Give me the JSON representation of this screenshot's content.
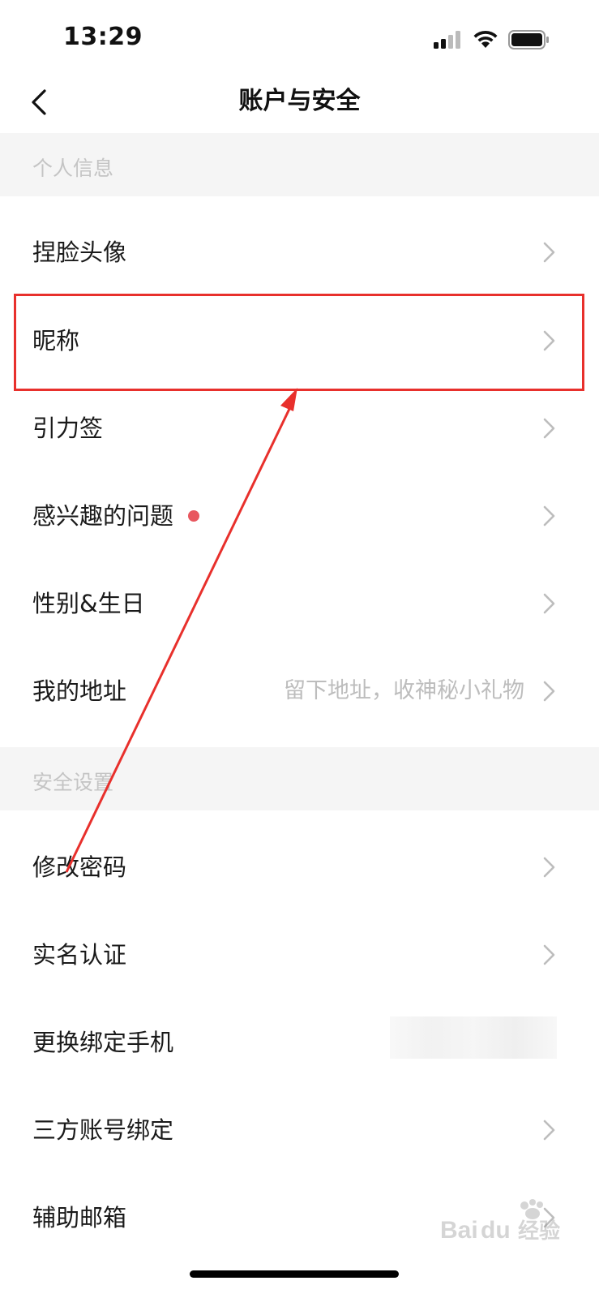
{
  "status_bar": {
    "time": "13:29"
  },
  "header": {
    "title": "账户与安全",
    "back_icon": "chevron-left-icon"
  },
  "sections": [
    {
      "title": "个人信息"
    },
    {
      "title": "安全设置"
    }
  ],
  "rows": [
    {
      "label": "捏脸头像"
    },
    {
      "label": "昵称"
    },
    {
      "label": "引力签"
    },
    {
      "label": "感兴趣的问题"
    },
    {
      "label": "性别&生日"
    },
    {
      "label": "我的地址",
      "hint": "留下地址，收神秘小礼物"
    },
    {
      "label": "修改密码"
    },
    {
      "label": "实名认证"
    },
    {
      "label": "更换绑定手机"
    },
    {
      "label": "三方账号绑定"
    },
    {
      "label": "辅助邮箱"
    }
  ],
  "annotation": {
    "color": "#e8302c"
  },
  "watermark": {
    "text": "Baidu经验"
  }
}
